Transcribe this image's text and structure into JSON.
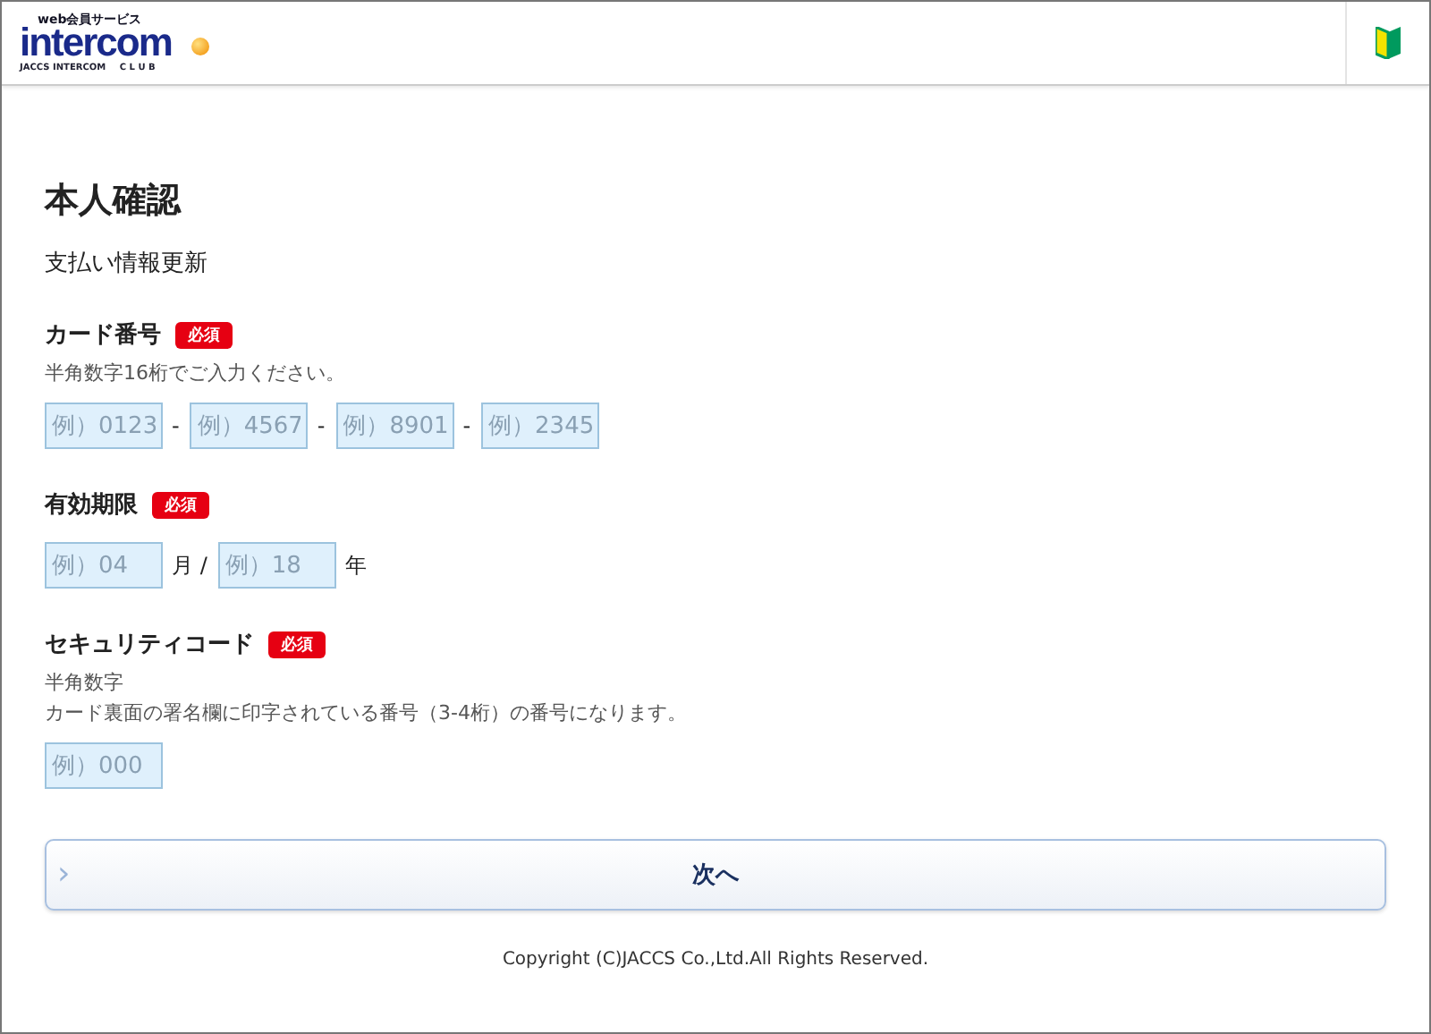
{
  "header": {
    "logo": {
      "tagline": "web会員サービス",
      "wordmark": "intercom",
      "subline": "JACCS INTERCOM",
      "club": "C L U B"
    }
  },
  "page": {
    "title": "本人確認",
    "subtitle": "支払い情報更新"
  },
  "sections": [
    {
      "label": "カード番号",
      "badge": "必須",
      "hints": [
        "半角数字16桁でご入力ください。"
      ],
      "fields": [
        {
          "placeholder": "例）0123",
          "after": "-"
        },
        {
          "placeholder": "例）4567",
          "after": "-"
        },
        {
          "placeholder": "例）8901",
          "after": "-"
        },
        {
          "placeholder": "例）2345"
        }
      ]
    },
    {
      "label": "有効期限",
      "badge": "必須",
      "fields": [
        {
          "placeholder": "例）04",
          "after": "月 /"
        },
        {
          "placeholder": "例）18",
          "after": "年"
        }
      ]
    },
    {
      "label": "セキュリティコード",
      "badge": "必須",
      "hints": [
        "半角数字",
        "カード裏面の署名欄に印字されている番号（3-4桁）の番号になります。"
      ],
      "fields": [
        {
          "placeholder": "例）000"
        }
      ]
    }
  ],
  "next_button": {
    "label": "次へ",
    "arrow": "›"
  },
  "footer": {
    "copyright": "Copyright (C)JACCS Co.,Ltd.All Rights Reserved."
  }
}
